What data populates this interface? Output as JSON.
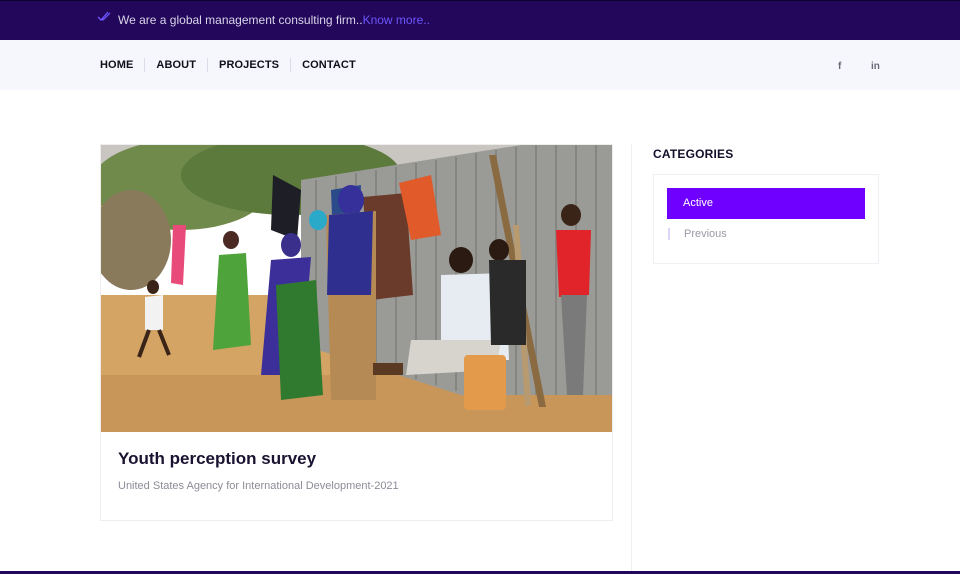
{
  "topbar": {
    "message": "We are a global management consulting firm..",
    "link": "Know more.."
  },
  "nav": {
    "items": [
      {
        "label": "HOME"
      },
      {
        "label": "ABOUT"
      },
      {
        "label": "PROJECTS"
      },
      {
        "label": "CONTACT"
      }
    ],
    "social": {
      "facebook": "f",
      "linkedin": "in"
    }
  },
  "project": {
    "title": "Youth perception survey",
    "subtitle": "United States Agency for International Development-2021"
  },
  "sidebar": {
    "heading": "CATEGORIES",
    "categories": [
      {
        "label": "Active",
        "selected": true
      },
      {
        "label": "Previous",
        "selected": false
      }
    ]
  },
  "colors": {
    "topbar": "#22075a",
    "accent": "#6f00ff",
    "link": "#6d56ff"
  }
}
